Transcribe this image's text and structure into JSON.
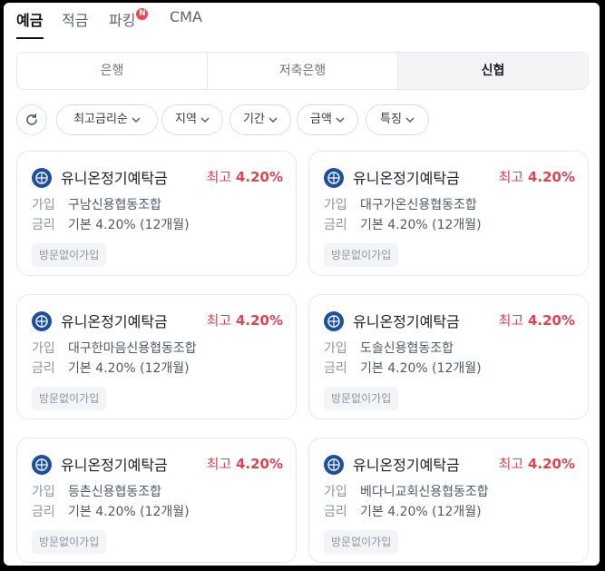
{
  "top_tabs": [
    {
      "label": "예금",
      "active": true
    },
    {
      "label": "적금",
      "active": false
    },
    {
      "label": "파킹",
      "active": false,
      "badge": "N"
    },
    {
      "label": "CMA",
      "active": false
    }
  ],
  "segments": [
    {
      "label": "은행",
      "active": false
    },
    {
      "label": "저축은행",
      "active": false
    },
    {
      "label": "신협",
      "active": true
    }
  ],
  "filters": {
    "sort": "최고금리순",
    "region": "지역",
    "period": "기간",
    "amount": "금액",
    "feature": "특징"
  },
  "colors": {
    "accent_rate": "#e2424e",
    "logo_blue": "#1d4f9c"
  },
  "products": [
    {
      "name": "유니온정기예탁금",
      "rate_prefix": "최고",
      "rate": "4.20%",
      "join_label": "가입",
      "join_value": "구남신용협동조합",
      "rate_label": "금리",
      "rate_value": "기본 4.20% (12개월)",
      "tag": "방문없이가입"
    },
    {
      "name": "유니온정기예탁금",
      "rate_prefix": "최고",
      "rate": "4.20%",
      "join_label": "가입",
      "join_value": "대구가온신용협동조합",
      "rate_label": "금리",
      "rate_value": "기본 4.20% (12개월)",
      "tag": "방문없이가입"
    },
    {
      "name": "유니온정기예탁금",
      "rate_prefix": "최고",
      "rate": "4.20%",
      "join_label": "가입",
      "join_value": "대구한마음신용협동조합",
      "rate_label": "금리",
      "rate_value": "기본 4.20% (12개월)",
      "tag": "방문없이가입"
    },
    {
      "name": "유니온정기예탁금",
      "rate_prefix": "최고",
      "rate": "4.20%",
      "join_label": "가입",
      "join_value": "도솔신용협동조합",
      "rate_label": "금리",
      "rate_value": "기본 4.20% (12개월)",
      "tag": "방문없이가입"
    },
    {
      "name": "유니온정기예탁금",
      "rate_prefix": "최고",
      "rate": "4.20%",
      "join_label": "가입",
      "join_value": "등촌신용협동조합",
      "rate_label": "금리",
      "rate_value": "기본 4.20% (12개월)",
      "tag": "방문없이가입"
    },
    {
      "name": "유니온정기예탁금",
      "rate_prefix": "최고",
      "rate": "4.20%",
      "join_label": "가입",
      "join_value": "베다니교회신용협동조합",
      "rate_label": "금리",
      "rate_value": "기본 4.20% (12개월)",
      "tag": "방문없이가입"
    }
  ]
}
